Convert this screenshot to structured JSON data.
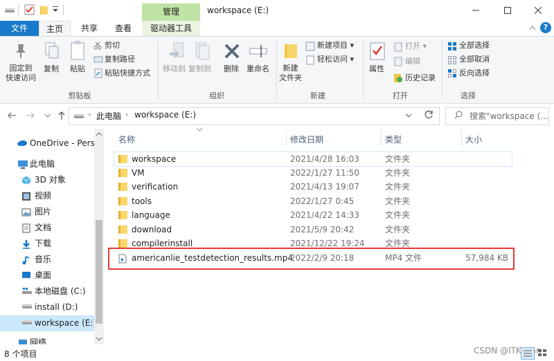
{
  "window": {
    "title": "workspace (E:)",
    "context_tab": "管理",
    "qat_icons": [
      "drive-icon",
      "properties-check-icon",
      "folder-icon",
      "dropdown-icon"
    ]
  },
  "ribbon_tabs": [
    {
      "label": "文件",
      "active": false
    },
    {
      "label": "主页",
      "active": true
    },
    {
      "label": "共享",
      "active": false
    },
    {
      "label": "查看",
      "active": false
    },
    {
      "label": "驱动器工具",
      "active": false
    }
  ],
  "ribbon": {
    "clipboard": {
      "title": "剪贴板",
      "pin": "固定到\n快速访问",
      "copy": "复制",
      "paste": "粘贴",
      "cut": "剪切",
      "copy_path": "复制路径",
      "paste_shortcut": "粘贴快捷方式"
    },
    "organize": {
      "title": "组织",
      "move_to": "移动到",
      "copy_to": "复制到",
      "delete": "删除",
      "rename": "重命名"
    },
    "new": {
      "title": "新建",
      "new_folder": "新建\n文件夹",
      "new_item": "新建项目",
      "easy_access": "轻松访问"
    },
    "open": {
      "title": "打开",
      "properties": "属性",
      "open": "打开",
      "edit": "编辑",
      "history": "历史记录"
    },
    "select": {
      "title": "选择",
      "select_all": "全部选择",
      "select_none": "全部取消",
      "invert": "反向选择"
    }
  },
  "address": {
    "breadcrumb": [
      "此电脑",
      "workspace (E:)"
    ],
    "search_placeholder": "搜索\"workspace (..."
  },
  "nav_pane": [
    {
      "label": "OneDrive - Perso",
      "icon": "cloud-icon"
    },
    {
      "label": "此电脑",
      "icon": "computer-icon"
    },
    {
      "label": "3D 对象",
      "icon": "cube-icon"
    },
    {
      "label": "视频",
      "icon": "video-icon"
    },
    {
      "label": "图片",
      "icon": "picture-icon"
    },
    {
      "label": "文档",
      "icon": "document-icon"
    },
    {
      "label": "下载",
      "icon": "download-icon"
    },
    {
      "label": "音乐",
      "icon": "music-icon"
    },
    {
      "label": "桌面",
      "icon": "desktop-icon"
    },
    {
      "label": "本地磁盘 (C:)",
      "icon": "windows-drive-icon"
    },
    {
      "label": "install (D:)",
      "icon": "drive-icon"
    },
    {
      "label": "workspace (E:)",
      "icon": "drive-icon",
      "selected": true
    },
    {
      "label": "网络",
      "icon": "network-icon"
    }
  ],
  "columns": {
    "name": "名称",
    "date": "修改日期",
    "type": "类型",
    "size": "大小"
  },
  "files": [
    {
      "name": "workspace",
      "date": "2021/4/28 16:03",
      "type": "文件夹",
      "size": "",
      "icon": "folder-icon"
    },
    {
      "name": "VM",
      "date": "2022/1/27 11:50",
      "type": "文件夹",
      "size": "",
      "icon": "folder-icon"
    },
    {
      "name": "verification",
      "date": "2021/4/13 19:07",
      "type": "文件夹",
      "size": "",
      "icon": "folder-icon"
    },
    {
      "name": "tools",
      "date": "2022/1/27 0:45",
      "type": "文件夹",
      "size": "",
      "icon": "folder-icon"
    },
    {
      "name": "language",
      "date": "2021/4/22 14:33",
      "type": "文件夹",
      "size": "",
      "icon": "folder-icon"
    },
    {
      "name": "download",
      "date": "2021/5/9 20:42",
      "type": "文件夹",
      "size": "",
      "icon": "folder-icon"
    },
    {
      "name": "compilerinstall",
      "date": "2021/12/22 19:24",
      "type": "文件夹",
      "size": "",
      "icon": "folder-icon"
    },
    {
      "name": "americanlie_testdetection_results.mp4",
      "date": "2022/2/9 20:18",
      "type": "MP4 文件",
      "size": "57,984 KB",
      "icon": "video-file-icon",
      "highlighted": true
    }
  ],
  "status": {
    "item_count": "8 个项目"
  },
  "watermark": "CSDN @ITKeyan",
  "colors": {
    "accent": "#1979ca",
    "context_tab": "#bfe3a5",
    "highlight_box": "#e53935",
    "folder": "#f4c542"
  }
}
